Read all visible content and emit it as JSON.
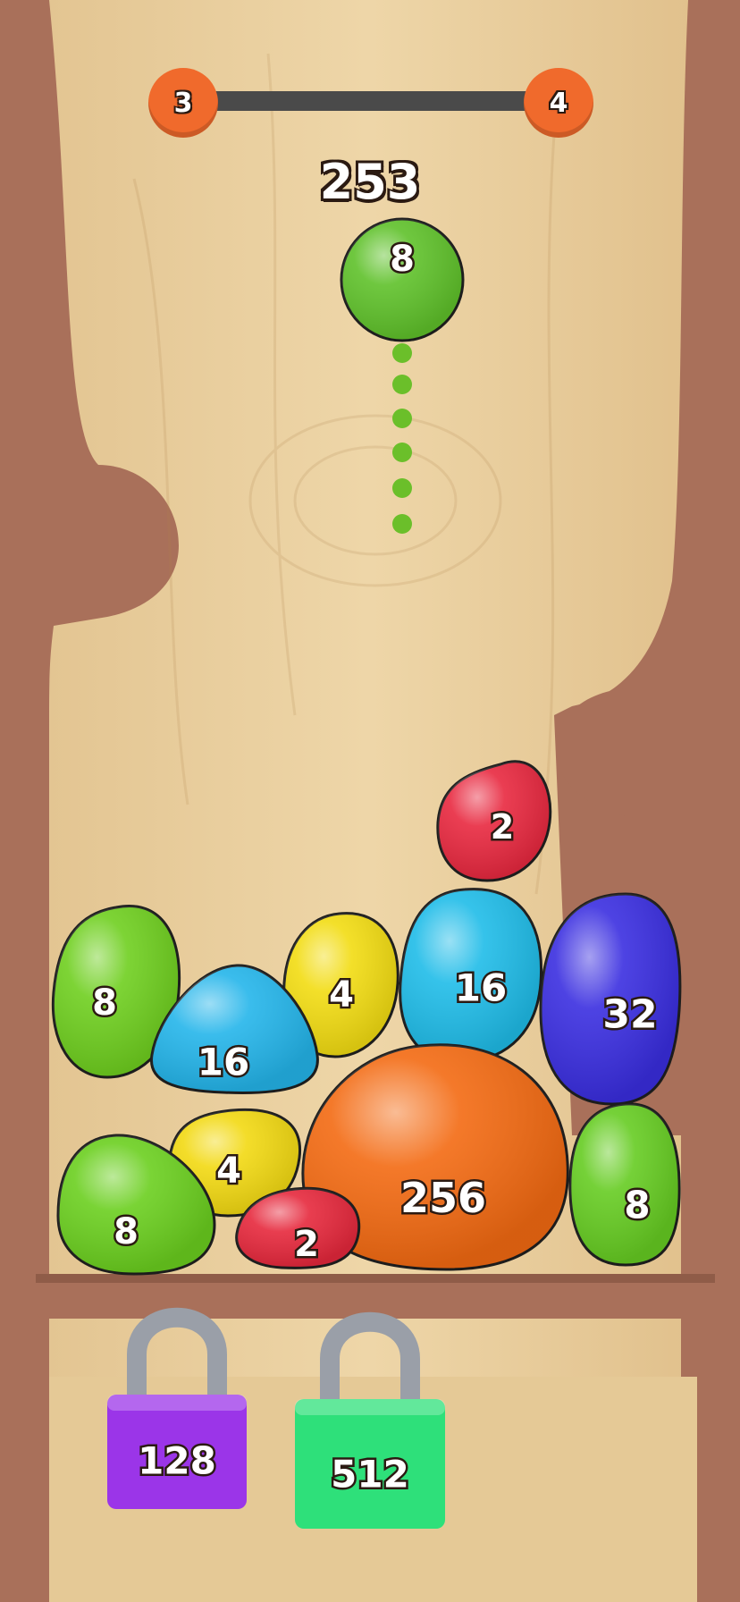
{
  "level": {
    "current": "3",
    "next": "4",
    "progress": 0.0
  },
  "score": "253",
  "next_blob": {
    "value": "8",
    "color": "#5fc12a"
  },
  "blobs": [
    {
      "value": "2",
      "color": "#e8283f"
    },
    {
      "value": "8",
      "color": "#6fcf1f"
    },
    {
      "value": "4",
      "color": "#f2dc12"
    },
    {
      "value": "16",
      "color": "#1fbce8"
    },
    {
      "value": "32",
      "color": "#3a2ee0"
    },
    {
      "value": "16",
      "color": "#24b5ea"
    },
    {
      "value": "256",
      "color": "#f36a12"
    },
    {
      "value": "4",
      "color": "#f2d912"
    },
    {
      "value": "8",
      "color": "#6bcf1f"
    },
    {
      "value": "8",
      "color": "#66cc22"
    },
    {
      "value": "2",
      "color": "#e6283c"
    }
  ],
  "locks": [
    {
      "value": "128",
      "color": "#9b35e8"
    },
    {
      "value": "512",
      "color": "#2ee07a"
    }
  ],
  "colors": {
    "wood_light": "#e9cf9f",
    "wood_frame": "#a9705a",
    "accent": "#f06a2c",
    "guide_dots": "#6bbf2a"
  }
}
